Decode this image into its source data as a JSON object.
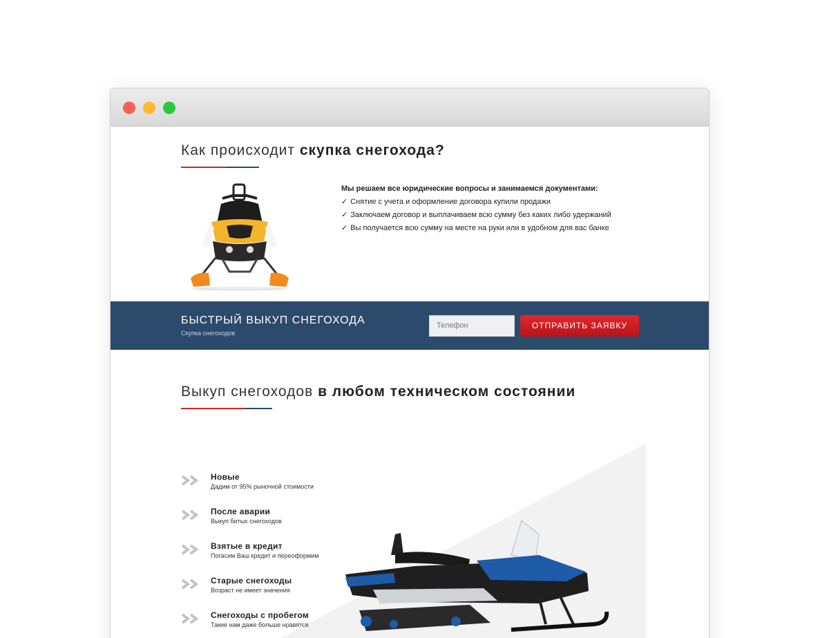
{
  "section1": {
    "title_light": "Как происходит ",
    "title_bold": "скупка снегохода?",
    "info_title": "Мы решаем все юридические вопросы и занимаемся документами:",
    "check_mark": "✓",
    "items": [
      "Снятие с учета и оформление договора купили продажи",
      "Заключаем договор и выплачиваем всю сумму без каких либо удержаний",
      "Вы получается всю сумму на месте на руки или в удобном для вас банке"
    ]
  },
  "banner": {
    "title": "БЫСТРЫЙ ВЫКУП СНЕГОХОДА",
    "subtitle": "Скупка снегоходов",
    "phone_placeholder": "Телефон",
    "submit_label": "ОТПРАВИТЬ ЗАЯВКУ"
  },
  "section2": {
    "title_light": "Выкуп снегоходов ",
    "title_bold": "в любом техническом состоянии",
    "items": [
      {
        "title": "Новые",
        "subtitle": "Дадим от 95% рыночной стоимости"
      },
      {
        "title": "После аварии",
        "subtitle": "Выкуп битых снегоходов"
      },
      {
        "title": "Взятые в кредит",
        "subtitle": "Погасим Ваш кредит и переоформим"
      },
      {
        "title": "Старые снегоходы",
        "subtitle": "Возраст не имеет значения"
      },
      {
        "title": "Снегоходы с пробегом",
        "subtitle": "Такие нам даже больше нравятся"
      }
    ]
  },
  "colors": {
    "accent_red": "#c8252c",
    "banner_blue": "#2c4a6b",
    "button_red": "#d41f25"
  },
  "icons": {
    "window_controls": [
      "close-dot",
      "minimize-dot",
      "maximize-dot"
    ],
    "list_arrow": "double-chevron-right-icon"
  }
}
